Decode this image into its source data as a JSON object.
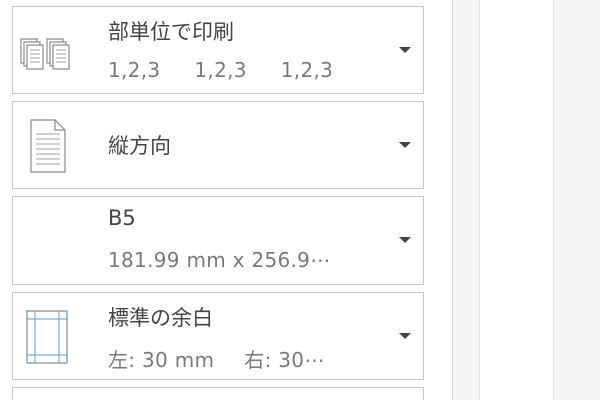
{
  "print_settings": {
    "collation": {
      "icon": "collated-pages-icon",
      "label": "部単位で印刷",
      "sub_parts": [
        "1,2,3",
        "1,2,3",
        "1,2,3"
      ]
    },
    "orientation": {
      "icon": "portrait-page-icon",
      "label": "縦方向"
    },
    "paper_size": {
      "label": "B5",
      "sub": "181.99 mm x 256.9⋯"
    },
    "margins": {
      "icon": "margins-icon",
      "label": "標準の余白",
      "sub_left": "左:  30 mm",
      "sub_right": "右:  30⋯"
    }
  },
  "colors": {
    "border": "#c6c6c6",
    "text": "#444444",
    "subtext": "#7a7a7a",
    "margin_guide": "#5b9bd5"
  }
}
